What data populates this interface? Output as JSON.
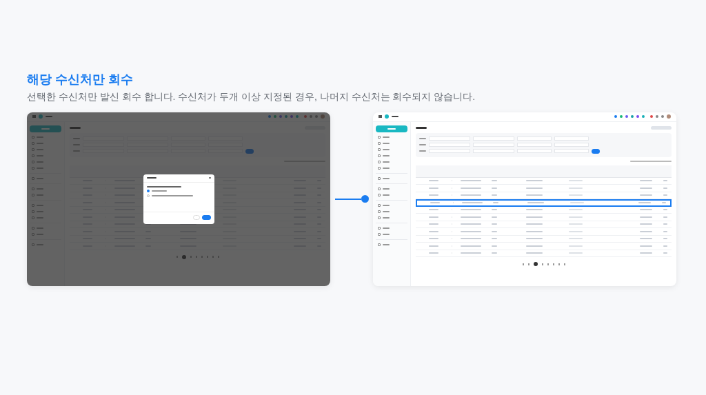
{
  "heading": {
    "title": "해당 수신처만 회수",
    "description": "선택한 수신처만 발신 회수 합니다. 수신처가 두개 이상 지정된 경우, 나머지 수신처는 회수되지 않습니다."
  },
  "connector": {
    "shown": true
  },
  "screens": [
    {
      "dimmed": true,
      "dialog": {
        "options": [
          {
            "selected": true
          },
          {
            "selected": false
          }
        ]
      },
      "rows": [
        {
          "highlighted": false
        },
        {
          "highlighted": false
        },
        {
          "highlighted": false
        },
        {
          "highlighted": false
        },
        {
          "highlighted": false
        },
        {
          "highlighted": false
        },
        {
          "highlighted": false
        },
        {
          "highlighted": false
        },
        {
          "highlighted": false
        },
        {
          "highlighted": false
        }
      ],
      "pages": [
        {
          "selected": false
        },
        {
          "selected": true
        },
        {
          "selected": false
        },
        {
          "selected": false
        },
        {
          "selected": false
        },
        {
          "selected": false
        },
        {
          "selected": false
        },
        {
          "selected": false
        }
      ]
    },
    {
      "dimmed": false,
      "rows": [
        {
          "highlighted": false
        },
        {
          "highlighted": false
        },
        {
          "highlighted": false
        },
        {
          "highlighted": true
        },
        {
          "highlighted": false
        },
        {
          "highlighted": false
        },
        {
          "highlighted": false
        },
        {
          "highlighted": false
        },
        {
          "highlighted": false
        },
        {
          "highlighted": false
        },
        {
          "highlighted": false
        }
      ],
      "pages": [
        {
          "selected": false
        },
        {
          "selected": false
        },
        {
          "selected": true
        },
        {
          "selected": false
        },
        {
          "selected": false
        },
        {
          "selected": false
        },
        {
          "selected": false
        },
        {
          "selected": false
        }
      ]
    }
  ]
}
